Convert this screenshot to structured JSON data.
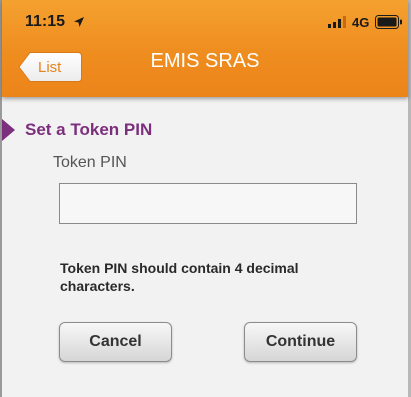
{
  "status_bar": {
    "time": "11:15",
    "location_icon": "location-arrow-icon",
    "signal_icon": "signal-bars-icon",
    "network": "4G",
    "battery_icon": "battery-icon"
  },
  "nav": {
    "back_label": "List",
    "title": "EMIS SRAS",
    "accent_color": "#ef8d1f"
  },
  "section": {
    "title": "Set a Token PIN",
    "title_color": "#7b2f7c"
  },
  "form": {
    "pin_label": "Token PIN",
    "pin_value": "",
    "pin_placeholder": "",
    "hint": "Token PIN should contain 4 decimal characters."
  },
  "actions": {
    "cancel_label": "Cancel",
    "continue_label": "Continue"
  }
}
